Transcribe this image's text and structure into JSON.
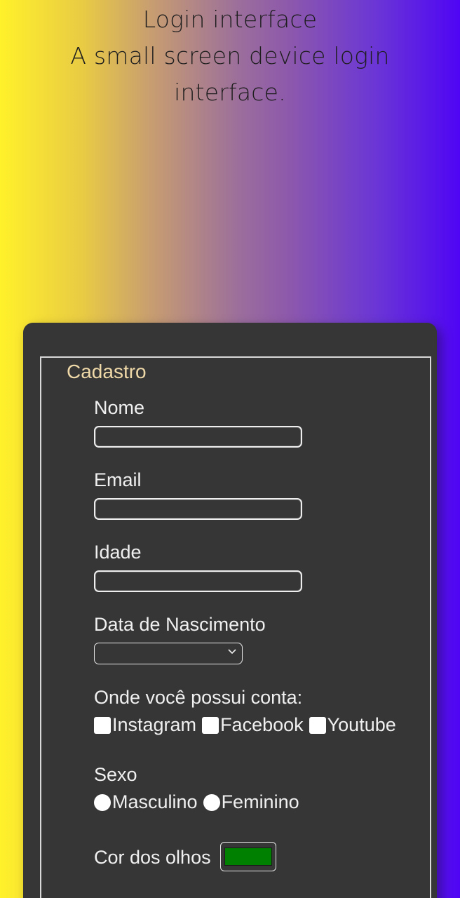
{
  "hero": {
    "title": "Login interface",
    "subtitle": "A small screen device login interface."
  },
  "form": {
    "legend": "Cadastro",
    "nome_label": "Nome",
    "nome_value": "",
    "email_label": "Email",
    "email_value": "",
    "idade_label": "Idade",
    "idade_value": "",
    "nascimento_label": "Data de Nascimento",
    "nascimento_value": "",
    "contas_label": "Onde você possui conta:",
    "contas_options": [
      "Instagram",
      "Facebook",
      "Youtube"
    ],
    "sexo_label": "Sexo",
    "sexo_options": [
      "Masculino",
      "Feminino"
    ],
    "cor_label": "Cor dos olhos",
    "cor_value": "#008000"
  },
  "colors": {
    "card_bg": "#363636",
    "legend": "#f0d9a8",
    "gradient_left": "#fff12a",
    "gradient_right": "#4f05f4"
  }
}
